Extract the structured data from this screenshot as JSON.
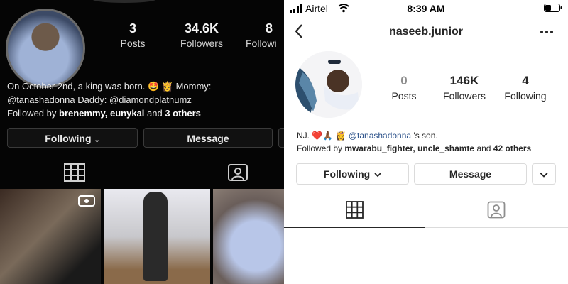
{
  "left": {
    "stats": [
      {
        "num": "3",
        "label": "Posts"
      },
      {
        "num": "34.6K",
        "label": "Followers"
      },
      {
        "num": "8",
        "label": "Followi"
      }
    ],
    "bio_line1": "On October 2nd, a king was born. 🤩 👸 Mommy:",
    "bio_line2": "@tanashadonna Daddy: @diamondplatnumz",
    "followed_prefix": "Followed by ",
    "followed_names": "brenemmy, eunykal",
    "followed_mid": " and ",
    "followed_others": "3 others",
    "following_btn": "Following",
    "message_btn": "Message"
  },
  "right": {
    "status": {
      "carrier": "Airtel",
      "time": "8:39 AM"
    },
    "username": "naseeb.junior",
    "stats": [
      {
        "num": "0",
        "label": "Posts"
      },
      {
        "num": "146K",
        "label": "Followers"
      },
      {
        "num": "4",
        "label": "Following"
      }
    ],
    "bio_prefix": "NJ. ❤️🙏🏾 👸 ",
    "bio_mention": "@tanashadonna",
    "bio_suffix": " 's son.",
    "followed_prefix": "Followed by ",
    "followed_names": "mwarabu_fighter, uncle_shamte",
    "followed_mid": " and ",
    "followed_others": "42 others",
    "following_btn": "Following",
    "message_btn": "Message"
  },
  "colors": {
    "link": "#30558c",
    "border": "#dbdbdb",
    "text": "#262626"
  }
}
